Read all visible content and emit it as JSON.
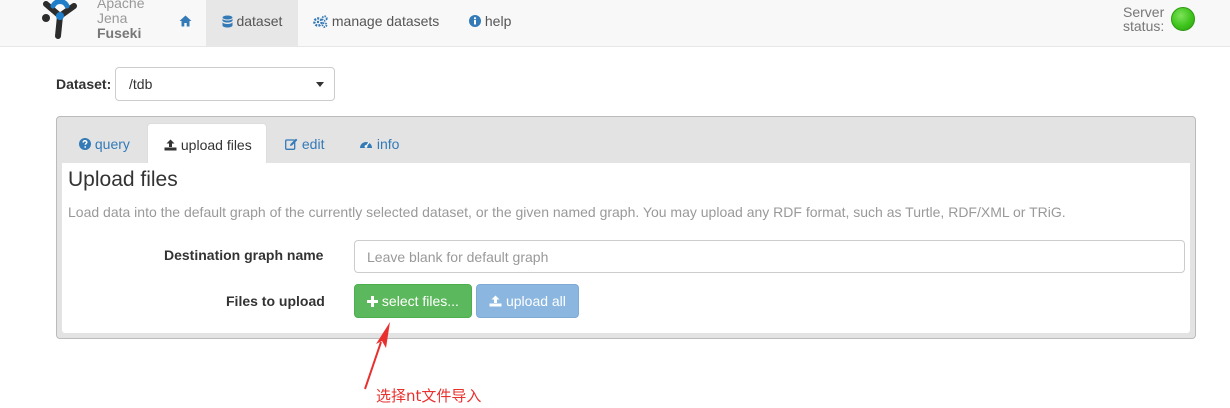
{
  "app": {
    "brand_line1": "Apache",
    "brand_line2": "Jena",
    "brand_line3": "Fuseki"
  },
  "navbar": {
    "items": [
      {
        "label": "",
        "icon": "home-icon",
        "active": false
      },
      {
        "label": "dataset",
        "icon": "database-icon",
        "active": true
      },
      {
        "label": "manage datasets",
        "icon": "cogs-icon",
        "active": false
      },
      {
        "label": "help",
        "icon": "info-circle-icon",
        "active": false
      }
    ],
    "server_status_line1": "Server",
    "server_status_line2": "status:",
    "server_status_color": "#3ec41b"
  },
  "dataset": {
    "label": "Dataset:",
    "selected": "/tdb"
  },
  "tabs": [
    {
      "label": "query",
      "icon": "question-circle-icon",
      "active": false
    },
    {
      "label": "upload files",
      "icon": "upload-icon",
      "active": true
    },
    {
      "label": "edit",
      "icon": "edit-icon",
      "active": false
    },
    {
      "label": "info",
      "icon": "dashboard-icon",
      "active": false
    }
  ],
  "upload": {
    "title": "Upload files",
    "description": "Load data into the default graph of the currently selected dataset, or the given named graph. You may upload any RDF format, such as Turtle, RDF/XML or TRiG.",
    "destination_label": "Destination graph name",
    "destination_placeholder": "Leave blank for default graph",
    "destination_value": "",
    "files_label": "Files to upload",
    "select_button": "select files...",
    "upload_all_button": "upload all"
  },
  "annotation": {
    "text": "选择nt文件导入",
    "color": "#e8312f"
  },
  "colors": {
    "accent": "#337ab7",
    "success": "#5cb85c",
    "primary_disabled": "#8ab6e0"
  }
}
